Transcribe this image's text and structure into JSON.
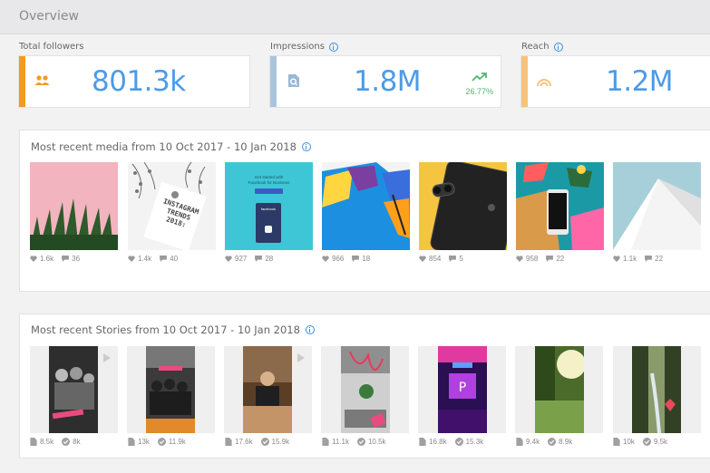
{
  "header": {
    "title": "Overview"
  },
  "stats": [
    {
      "label": "Total followers",
      "value": "801.3k",
      "accent": "#f39a22",
      "icon": "people-icon",
      "info": false
    },
    {
      "label": "Impressions",
      "value": "1.8M",
      "accent": "#a9c5de",
      "icon": "magnify-doc-icon",
      "info": true,
      "trend": "26.77%"
    },
    {
      "label": "Reach",
      "value": "1.2M",
      "accent": "#f7c37a",
      "icon": "rainbow-icon",
      "info": true
    }
  ],
  "media": {
    "title": "Most recent media from 10 Oct 2017 - 10 Jan 2018",
    "items": [
      {
        "likes": "1.6k",
        "comments": "36"
      },
      {
        "likes": "1.4k",
        "comments": "40"
      },
      {
        "likes": "927",
        "comments": "28"
      },
      {
        "likes": "966",
        "comments": "18"
      },
      {
        "likes": "854",
        "comments": "5"
      },
      {
        "likes": "958",
        "comments": "22"
      },
      {
        "likes": "1.1k",
        "comments": "22"
      }
    ],
    "image_text": {
      "trends_line1": "INSTAGRAM",
      "trends_line2": "TRENDS",
      "trends_line3": "2018:",
      "fb_line1": "Get started with",
      "fb_line2": "Facebook for Business",
      "fb_badge": "facebook"
    }
  },
  "stories": {
    "title": "Most recent Stories from 10 Oct 2017 - 10 Jan 2018",
    "items": [
      {
        "impressions": "8.5k",
        "reach": "8k"
      },
      {
        "impressions": "13k",
        "reach": "11.9k"
      },
      {
        "impressions": "17.6k",
        "reach": "15.9k"
      },
      {
        "impressions": "11.1k",
        "reach": "10.5k"
      },
      {
        "impressions": "16.8k",
        "reach": "15.3k"
      },
      {
        "impressions": "9.4k",
        "reach": "8.9k"
      },
      {
        "impressions": "10k",
        "reach": "9.5k"
      }
    ]
  }
}
